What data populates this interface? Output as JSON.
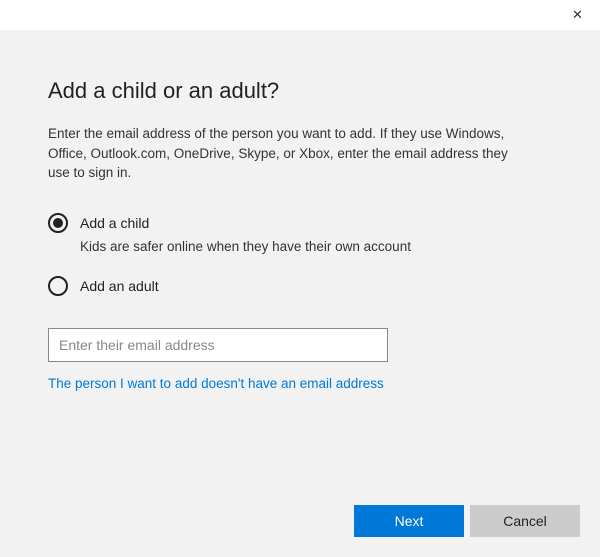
{
  "window": {
    "close_glyph": "✕"
  },
  "title": "Add a child or an adult?",
  "description": "Enter the email address of the person you want to add. If they use Windows, Office, Outlook.com, OneDrive, Skype, or Xbox, enter the email address they use to sign in.",
  "options": {
    "child": {
      "label": "Add a child",
      "sublabel": "Kids are safer online when they have their own account",
      "selected": true
    },
    "adult": {
      "label": "Add an adult",
      "selected": false
    }
  },
  "email": {
    "placeholder": "Enter their email address",
    "value": ""
  },
  "no_email_link": "The person I want to add doesn't have an email address",
  "buttons": {
    "next": "Next",
    "cancel": "Cancel"
  }
}
